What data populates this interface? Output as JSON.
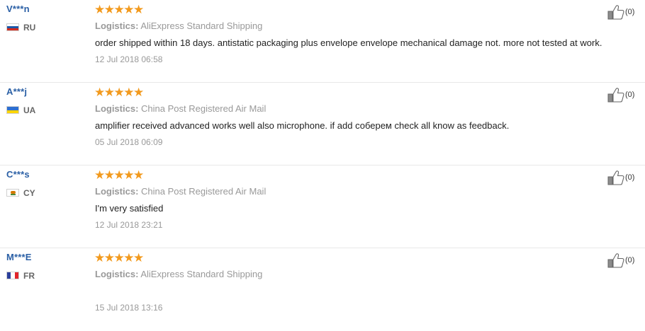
{
  "stars": "★★★★★",
  "logistics_label": "Logistics:",
  "reviews": [
    {
      "user": "V***n",
      "country_code": "RU",
      "flag_colors": [
        "#ffffff",
        "#1c57a7",
        "#d52b1e"
      ],
      "flag_orientation": "horizontal",
      "rating": 5,
      "logistics": "AliExpress Standard Shipping",
      "feedback": "order shipped within 18 days. antistatic packaging plus envelope envelope mechanical damage not. more not tested at work.",
      "date": "12 Jul 2018 06:58",
      "helpful": "(0)"
    },
    {
      "user": "A***j",
      "country_code": "UA",
      "flag_colors": [
        "#2e6fd0",
        "#ffd500"
      ],
      "flag_orientation": "horizontal",
      "rating": 5,
      "logistics": "China Post Registered Air Mail",
      "feedback": "amplifier received advanced works well also microphone. if add соберем check all know as feedback.",
      "date": "05 Jul 2018 06:09",
      "helpful": "(0)"
    },
    {
      "user": "C***s",
      "country_code": "CY",
      "flag_colors": [
        "#ffffff",
        "#d57800",
        "#4e8a3a"
      ],
      "flag_orientation": "emblem",
      "rating": 5,
      "logistics": "China Post Registered Air Mail",
      "feedback": "I'm very satisfied",
      "date": "12 Jul 2018 23:21",
      "helpful": "(0)"
    },
    {
      "user": "M***E",
      "country_code": "FR",
      "flag_colors": [
        "#2b3f9b",
        "#ffffff",
        "#e1242a"
      ],
      "flag_orientation": "vertical",
      "rating": 5,
      "logistics": "AliExpress Standard Shipping",
      "feedback": "",
      "date": "15 Jul 2018 13:16",
      "helpful": "(0)"
    }
  ]
}
